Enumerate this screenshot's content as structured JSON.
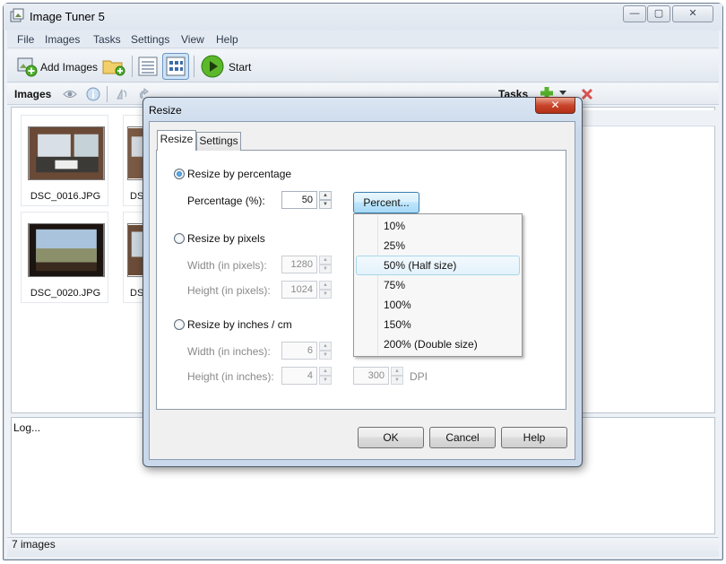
{
  "app": {
    "title": "Image Tuner 5"
  },
  "window_controls": {
    "minimize": "—",
    "maximize": "▢",
    "close": "✕"
  },
  "menu": [
    "File",
    "Images",
    "Tasks",
    "Settings",
    "View",
    "Help"
  ],
  "toolbar": {
    "add_images": "Add Images",
    "start": "Start"
  },
  "subbar": {
    "images_label": "Images",
    "tasks_label": "Tasks"
  },
  "thumbnails": [
    {
      "name": "DSC_0016.JPG"
    },
    {
      "name": "DSC_0020.JPG"
    }
  ],
  "partial_thumbnails": [
    {
      "name": "DS"
    },
    {
      "name": "DS"
    }
  ],
  "log": {
    "text": "Log..."
  },
  "status": {
    "text": "7 images"
  },
  "dialog": {
    "title": "Resize",
    "close": "✕",
    "tabs": [
      "Resize",
      "Settings"
    ],
    "active_tab": "Resize",
    "by_percentage": {
      "label": "Resize by percentage",
      "selected": true,
      "percentage_label": "Percentage (%):",
      "percentage_value": "50",
      "percent_button": "Percent..."
    },
    "by_pixels": {
      "label": "Resize by pixels",
      "selected": false,
      "width_label": "Width (in pixels):",
      "width_value": "1280",
      "height_label": "Height (in pixels):",
      "height_value": "1024"
    },
    "by_inches": {
      "label": "Resize by inches / cm",
      "selected": false,
      "width_label": "Width (in inches):",
      "width_value": "6",
      "height_label": "Height (in inches):",
      "height_value": "4",
      "dpi_value": "300",
      "dpi_label": "DPI"
    },
    "percent_menu": {
      "items": [
        "10%",
        "25%",
        "50% (Half size)",
        "75%",
        "100%",
        "150%",
        "200% (Double size)"
      ],
      "highlighted": "50% (Half size)"
    },
    "buttons": {
      "ok": "OK",
      "cancel": "Cancel",
      "help": "Help"
    }
  },
  "colors": {
    "dialog_close": "#c9452b",
    "accent_blue": "#3c7fb1",
    "start_green": "#5cb82a"
  }
}
